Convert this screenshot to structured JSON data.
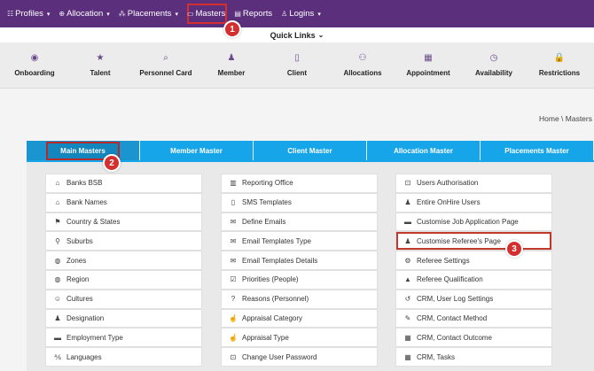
{
  "nav": {
    "items": [
      {
        "label": "Profiles",
        "icon": "profiles-icon",
        "glyph": "☷",
        "chevron": true
      },
      {
        "label": "Allocation",
        "icon": "allocation-icon",
        "glyph": "⊕",
        "chevron": true
      },
      {
        "label": "Placements",
        "icon": "placements-icon",
        "glyph": "⁂",
        "chevron": true
      },
      {
        "label": "Masters",
        "icon": "folder-icon",
        "glyph": "▭",
        "chevron": false
      },
      {
        "label": "Reports",
        "icon": "reports-icon",
        "glyph": "▤",
        "chevron": false
      },
      {
        "label": "Logins",
        "icon": "user-icon",
        "glyph": "♙",
        "chevron": true
      }
    ]
  },
  "quick_links": {
    "label": "Quick Links"
  },
  "tiles": [
    {
      "label": "Onboarding",
      "icon": "onboarding-icon",
      "glyph": "◉"
    },
    {
      "label": "Talent",
      "icon": "star-icon",
      "glyph": "★"
    },
    {
      "label": "Personnel Card",
      "icon": "search-icon",
      "glyph": "⌕"
    },
    {
      "label": "Member",
      "icon": "member-icon",
      "glyph": "♟"
    },
    {
      "label": "Client",
      "icon": "client-icon",
      "glyph": "▯"
    },
    {
      "label": "Allocations",
      "icon": "allocations-icon",
      "glyph": "⚇"
    },
    {
      "label": "Appointment",
      "icon": "calendar-icon",
      "glyph": "▦"
    },
    {
      "label": "Availability",
      "icon": "clock-icon",
      "glyph": "◷"
    },
    {
      "label": "Restrictions",
      "icon": "lock-icon",
      "glyph": "🔒"
    }
  ],
  "breadcrumb": {
    "text": "Home \\ Masters"
  },
  "tabs": [
    {
      "label": "Main Masters",
      "active": true
    },
    {
      "label": "Member Master",
      "active": false
    },
    {
      "label": "Client Master",
      "active": false
    },
    {
      "label": "Allocation Master",
      "active": false
    },
    {
      "label": "Placements Master",
      "active": false
    }
  ],
  "columns": [
    [
      {
        "label": "Banks BSB",
        "icon": "bank-icon",
        "glyph": "⌂"
      },
      {
        "label": "Bank Names",
        "icon": "bank-icon",
        "glyph": "⌂"
      },
      {
        "label": "Country & States",
        "icon": "flag-icon",
        "glyph": "⚑"
      },
      {
        "label": "Suburbs",
        "icon": "map-marker-icon",
        "glyph": "⚲"
      },
      {
        "label": "Zones",
        "icon": "globe-icon",
        "glyph": "◍"
      },
      {
        "label": "Region",
        "icon": "globe-icon",
        "glyph": "◍"
      },
      {
        "label": "Cultures",
        "icon": "smile-icon",
        "glyph": "☺"
      },
      {
        "label": "Designation",
        "icon": "person-icon",
        "glyph": "♟"
      },
      {
        "label": "Employment Type",
        "icon": "briefcase-icon",
        "glyph": "▬"
      },
      {
        "label": "Languages",
        "icon": "language-icon",
        "glyph": "⅍"
      }
    ],
    [
      {
        "label": "Reporting Office",
        "icon": "building-icon",
        "glyph": "▥"
      },
      {
        "label": "SMS Templates",
        "icon": "mobile-icon",
        "glyph": "▯"
      },
      {
        "label": "Define Emails",
        "icon": "envelope-icon",
        "glyph": "✉"
      },
      {
        "label": "Email Templates Type",
        "icon": "envelope-icon",
        "glyph": "✉"
      },
      {
        "label": "Email Templates Details",
        "icon": "envelope-icon",
        "glyph": "✉"
      },
      {
        "label": "Priorities (People)",
        "icon": "check-square-icon",
        "glyph": "☑"
      },
      {
        "label": "Reasons (Personnel)",
        "icon": "question-icon",
        "glyph": "?"
      },
      {
        "label": "Appraisal Category",
        "icon": "thumbs-up-icon",
        "glyph": "☝"
      },
      {
        "label": "Appraisal Type",
        "icon": "thumbs-up-icon",
        "glyph": "☝"
      },
      {
        "label": "Change User Password",
        "icon": "unlock-icon",
        "glyph": "⊡"
      }
    ],
    [
      {
        "label": "Users Authorisation",
        "icon": "lock-icon",
        "glyph": "⊡"
      },
      {
        "label": "Entire OnHire Users",
        "icon": "users-icon",
        "glyph": "♟"
      },
      {
        "label": "Customise Job Application Page",
        "icon": "briefcase-icon",
        "glyph": "▬"
      },
      {
        "label": "Customise Referee's Page",
        "icon": "user-plus-icon",
        "glyph": "♟"
      },
      {
        "label": "Referee Settings",
        "icon": "cogs-icon",
        "glyph": "⚙"
      },
      {
        "label": "Referee Qualification",
        "icon": "graduation-icon",
        "glyph": "▲"
      },
      {
        "label": "CRM, User Log Settings",
        "icon": "history-icon",
        "glyph": "↺"
      },
      {
        "label": "CRM, Contact Method",
        "icon": "pencil-icon",
        "glyph": "✎"
      },
      {
        "label": "CRM, Contact Outcome",
        "icon": "calendar-icon",
        "glyph": "▦"
      },
      {
        "label": "CRM, Tasks",
        "icon": "calendar-icon",
        "glyph": "▦"
      }
    ]
  ],
  "badges": [
    "1",
    "2",
    "3"
  ],
  "colors": {
    "nav_bg": "#5b2f7c",
    "tab_bg": "#16a5e8",
    "highlight": "#d32f2f"
  }
}
